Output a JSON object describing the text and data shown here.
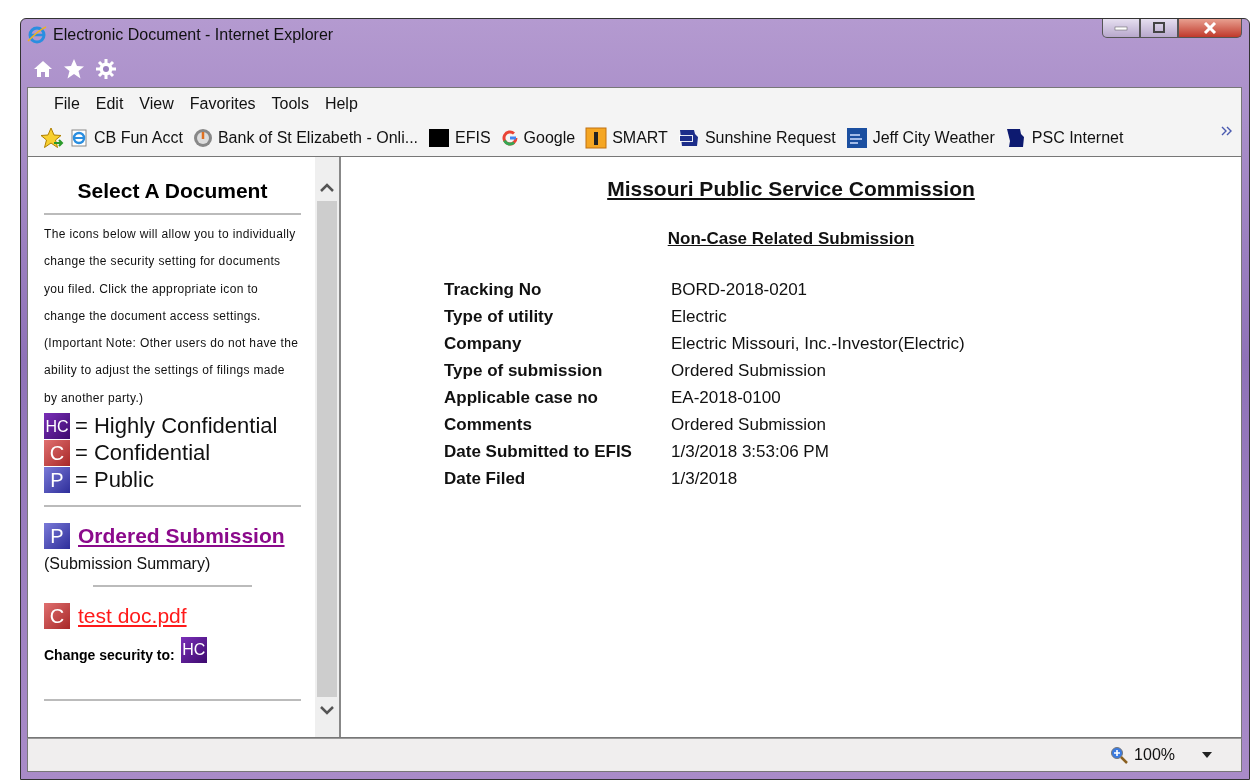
{
  "window": {
    "title": "Electronic Document - Internet Explorer"
  },
  "menu": [
    "File",
    "Edit",
    "View",
    "Favorites",
    "Tools",
    "Help"
  ],
  "favorites": [
    {
      "label": "CB Fun Acct",
      "kind": "ie"
    },
    {
      "label": "Bank of St Elizabeth - Onli...",
      "kind": "bank"
    },
    {
      "label": "EFIS",
      "kind": "black"
    },
    {
      "label": "Google",
      "kind": "google"
    },
    {
      "label": "SMART",
      "kind": "info"
    },
    {
      "label": "Sunshine Request",
      "kind": "mystate"
    },
    {
      "label": "Jeff City Weather",
      "kind": "weather"
    },
    {
      "label": "PSC Internet",
      "kind": "state"
    }
  ],
  "left_panel": {
    "heading": "Select A Document",
    "intro": "The icons below will allow you to individually change the security setting for documents you filed. Click the appropriate icon to change the document access settings. (Important Note: Other users do not have the ability to adjust the settings of filings made by another party.)",
    "legend": [
      {
        "badge": "HC",
        "kind": "hc",
        "label": "= Highly Confidential"
      },
      {
        "badge": "C",
        "kind": "c",
        "label": "= Confidential"
      },
      {
        "badge": "P",
        "kind": "p",
        "label": "= Public"
      }
    ],
    "documents": [
      {
        "badge": "P",
        "kind": "p",
        "title": "Ordered Submission",
        "visited": true,
        "note": "(Submission Summary)"
      },
      {
        "badge": "C",
        "kind": "c",
        "title": "test doc.pdf",
        "visited": false,
        "change_label": "Change security to:",
        "change_to": {
          "badge": "HC",
          "kind": "hc"
        }
      }
    ]
  },
  "main": {
    "title": "Missouri Public Service Commission",
    "subtitle": "Non-Case Related Submission",
    "fields": [
      {
        "label": "Tracking No",
        "value": "BORD-2018-0201"
      },
      {
        "label": "Type of utility",
        "value": "Electric"
      },
      {
        "label": "Company",
        "value": "Electric Missouri, Inc.-Investor(Electric)"
      },
      {
        "label": "Type of submission",
        "value": "Ordered Submission"
      },
      {
        "label": "Applicable case no",
        "value": "EA-2018-0100"
      },
      {
        "label": "Comments",
        "value": "Ordered Submission"
      },
      {
        "label": "Date Submitted to EFIS",
        "value": "1/3/2018 3:53:06 PM"
      },
      {
        "label": "Date Filed",
        "value": "1/3/2018"
      }
    ]
  },
  "status_bar": {
    "zoom": "100%"
  }
}
